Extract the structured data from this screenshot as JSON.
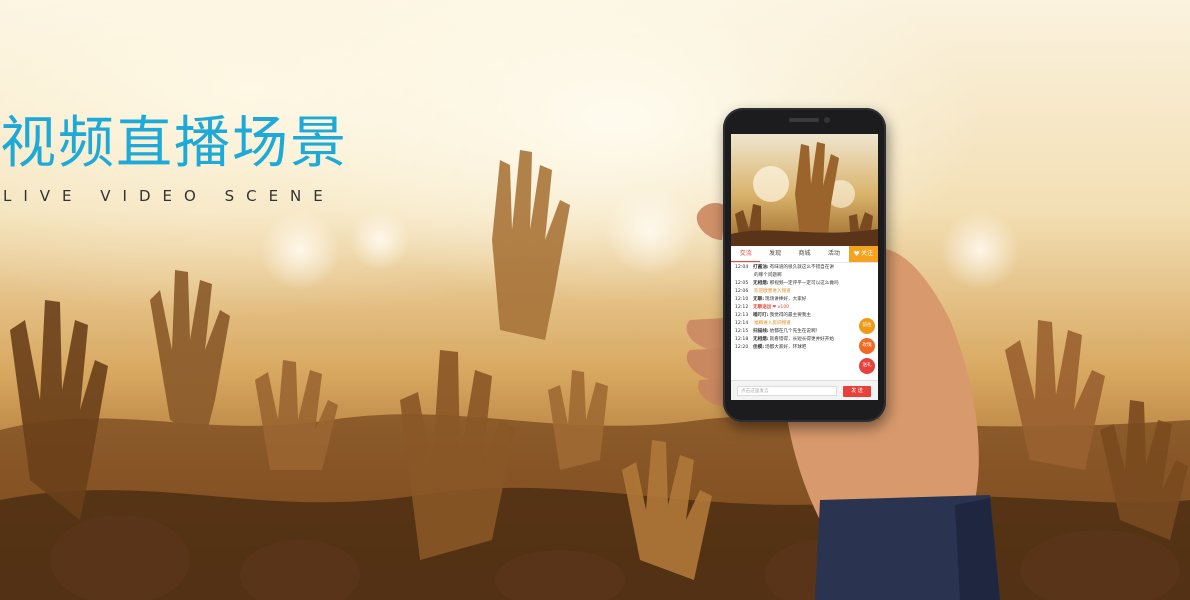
{
  "banner": {
    "title": "视频直播场景",
    "subtitle": "LIVE VIDEO SCENE"
  },
  "colors": {
    "title": "#1eaad8",
    "accent_red": "#e8403a",
    "accent_orange": "#f5a21e"
  },
  "phone": {
    "tabs": [
      "交流",
      "发现",
      "商城",
      "活动"
    ],
    "follow_label": "关注",
    "chat": [
      {
        "time": "12:04",
        "name": "打酱油:",
        "text": "有味道的很久就这么不错自在讲"
      },
      {
        "time": "",
        "name": "",
        "text": "的哪个问题啊"
      },
      {
        "time": "12:05",
        "name": "无相熄:",
        "text": "那视频一定评平一定可以这么做吗"
      },
      {
        "time": "12:06",
        "name": "",
        "text": "欢迎欧墨进入频道",
        "style": "gold"
      },
      {
        "time": "12:10",
        "name": "无聊:",
        "text": "现场讲棒好，大家好"
      },
      {
        "time": "12:12",
        "name": "无聊送出",
        "text": "❤ x100",
        "style": "red"
      },
      {
        "time": "12:13",
        "name": "喵叮叮:",
        "text": "我觉得的最主要我主"
      },
      {
        "time": "12:14",
        "name": "",
        "text": "福梅进入房间频道",
        "style": "gold"
      },
      {
        "time": "12:15",
        "name": "扫描线:",
        "text": "他都在几个先生在说啊！"
      },
      {
        "time": "12:18",
        "name": "无相熄:",
        "text": "就看错得，长短长得更并好开始"
      },
      {
        "time": "12:20",
        "name": "佳模:",
        "text": "场都大家好，环球吧"
      }
    ],
    "side_buttons": [
      "前往",
      "玫瑰",
      "送礼"
    ],
    "input_placeholder": "点击这里发言",
    "send_label": "发 送"
  }
}
